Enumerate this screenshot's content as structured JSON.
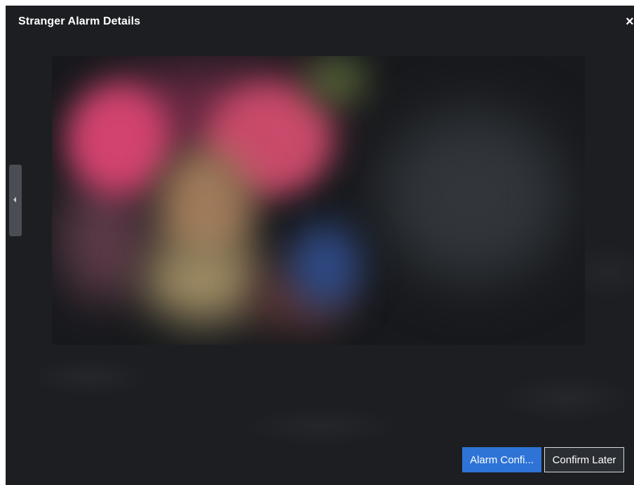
{
  "dialog": {
    "title": "Stranger Alarm Details",
    "close_glyph": "×",
    "close_icon": "close-icon"
  },
  "side_handle": {
    "icon": "caret-left-icon"
  },
  "buttons": {
    "primary_label": "Alarm Confi...",
    "secondary_label": "Confirm Later"
  },
  "colors": {
    "background": "#1c1e21",
    "primary": "#2e74d6",
    "text": "#ffffff"
  }
}
